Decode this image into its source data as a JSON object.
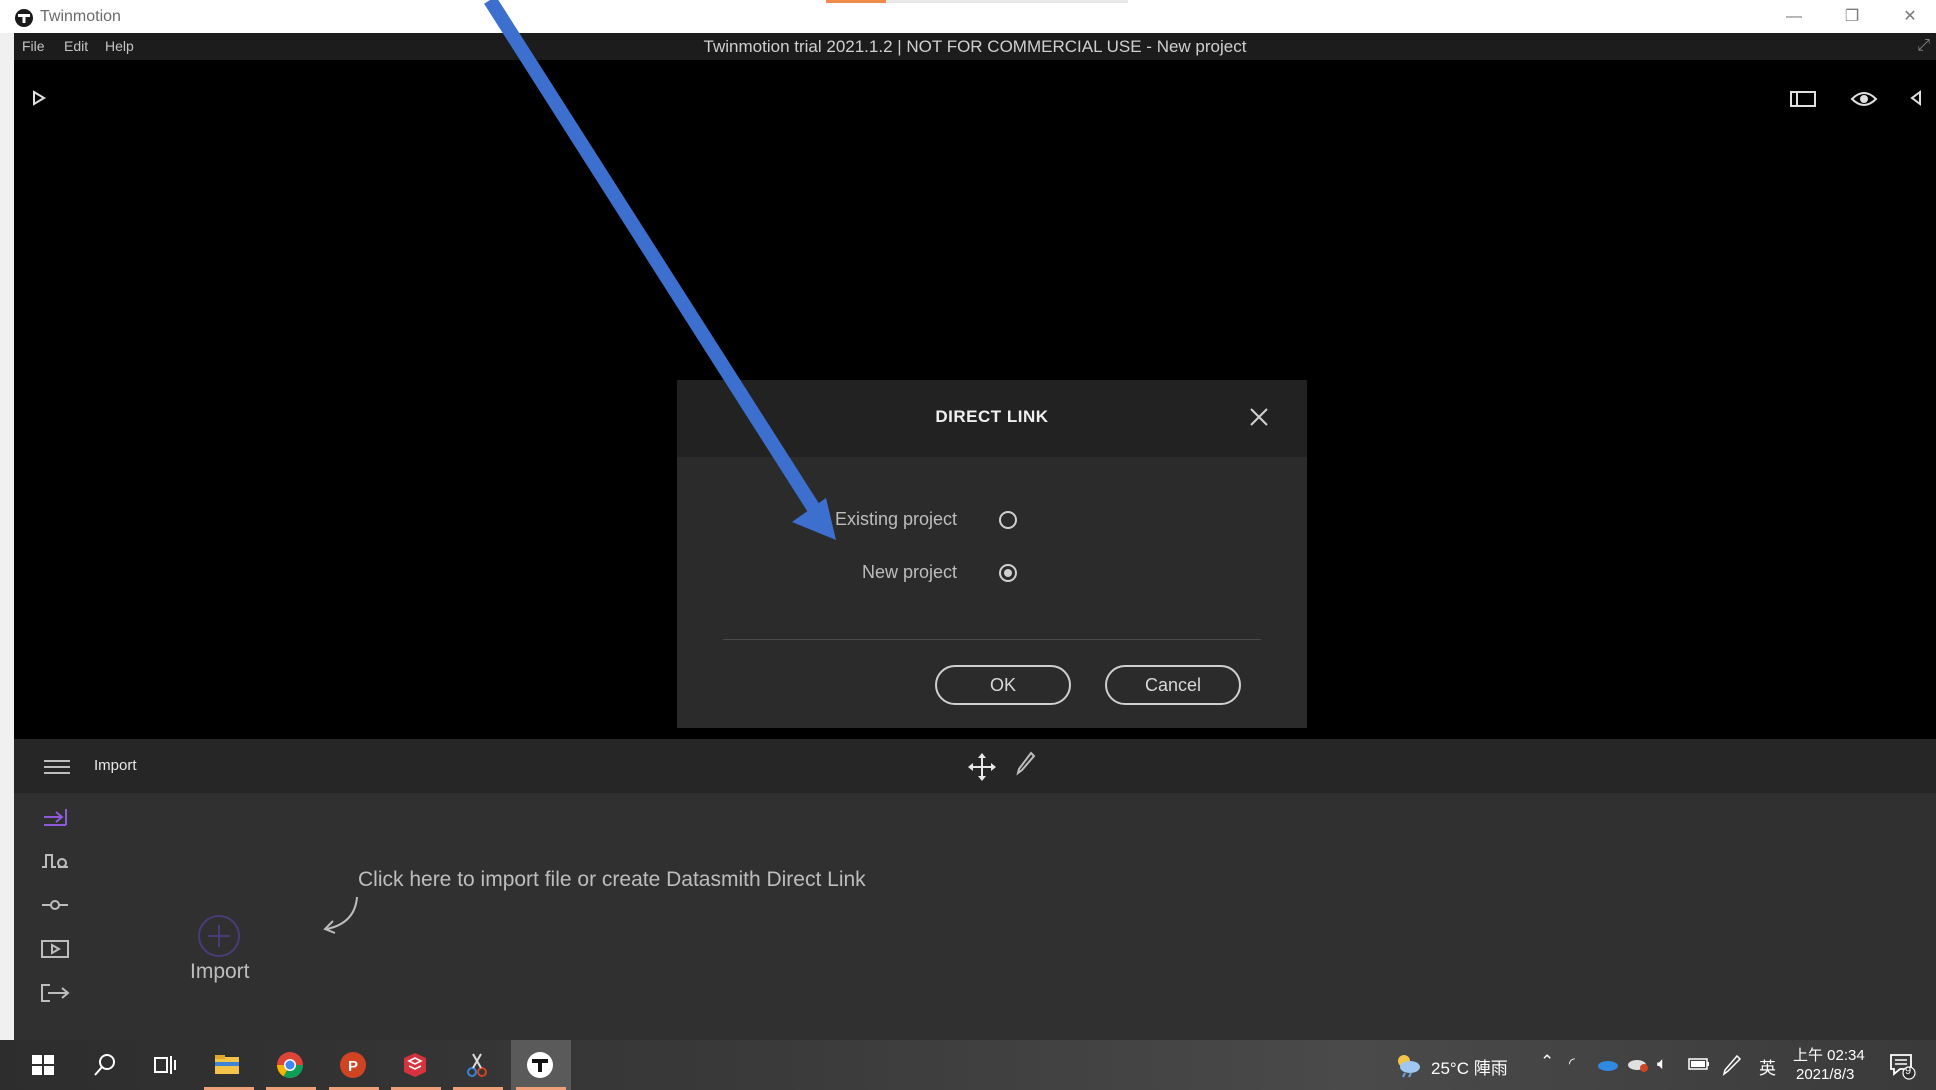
{
  "window": {
    "app_name": "Twinmotion",
    "minimize": "—",
    "restore": "❐",
    "close": "✕"
  },
  "app": {
    "menu": [
      "File",
      "Edit",
      "Help"
    ],
    "title": "Twinmotion trial 2021.1.2 | NOT FOR COMMERCIAL USE - New project"
  },
  "dialog": {
    "title": "DIRECT LINK",
    "options": [
      {
        "label": "Existing project",
        "selected": false
      },
      {
        "label": "New project",
        "selected": true
      }
    ],
    "ok_label": "OK",
    "cancel_label": "Cancel"
  },
  "panel": {
    "title": "Import",
    "import_hint": "Click here to import file or create Datasmith Direct Link",
    "import_label": "Import"
  },
  "taskbar": {
    "weather": "25°C 陣雨",
    "ime": "英",
    "time": "上午 02:34",
    "date": "2021/8/3",
    "notifications": "9"
  },
  "colors": {
    "accent_purple": "#8e5bd6",
    "annotation_arrow": "#3d6fcf"
  }
}
